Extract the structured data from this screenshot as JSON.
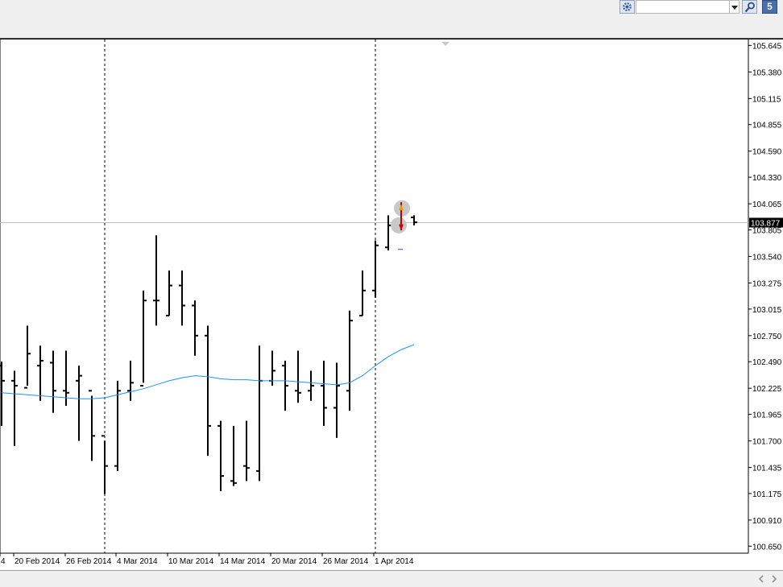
{
  "toolbar": {
    "search_value": "",
    "badge": "5",
    "icons": [
      "gear-icon",
      "chevron-down-icon",
      "search-icon"
    ]
  },
  "price_scale": {
    "labels": [
      "105.645",
      "105.380",
      "105.115",
      "104.855",
      "104.590",
      "104.330",
      "104.065",
      "103.805",
      "103.540",
      "103.275",
      "103.015",
      "102.750",
      "102.490",
      "102.225",
      "101.965",
      "101.700",
      "101.435",
      "101.175",
      "100.910",
      "100.650"
    ],
    "current": "103.877"
  },
  "time_scale": {
    "labels": [
      "4",
      "20 Feb 2014",
      "26 Feb 2014",
      "4 Mar 2014",
      "10 Mar 2014",
      "14 Mar 2014",
      "20 Mar 2014",
      "26 Mar 2014",
      "1 Apr 2014"
    ]
  },
  "chart_data": {
    "type": "bar",
    "title": "",
    "xlabel": "",
    "ylabel": "",
    "ylim": [
      100.58,
      105.68
    ],
    "grid": false,
    "current_price": 103.877,
    "bars": [
      {
        "o": 102.45,
        "h": 102.49,
        "l": 101.85,
        "c": 102.3
      },
      {
        "o": 102.3,
        "h": 102.4,
        "l": 101.65,
        "c": 102.25
      },
      {
        "o": 102.23,
        "h": 102.85,
        "l": 102.25,
        "c": 102.57
      },
      {
        "o": 102.45,
        "h": 102.65,
        "l": 102.1,
        "c": 102.5
      },
      {
        "o": 102.48,
        "h": 102.6,
        "l": 101.98,
        "c": 102.2
      },
      {
        "o": 102.2,
        "h": 102.6,
        "l": 102.05,
        "c": 102.18
      },
      {
        "o": 102.3,
        "h": 102.45,
        "l": 101.7,
        "c": 102.35
      },
      {
        "o": 102.2,
        "h": 102.15,
        "l": 101.5,
        "c": 101.75
      },
      {
        "o": 101.75,
        "h": 101.7,
        "l": 101.17,
        "c": 101.45
      },
      {
        "o": 101.45,
        "h": 102.3,
        "l": 101.4,
        "c": 102.2
      },
      {
        "o": 102.2,
        "h": 102.5,
        "l": 102.1,
        "c": 102.28
      },
      {
        "o": 102.25,
        "h": 103.2,
        "l": 102.28,
        "c": 103.1
      },
      {
        "o": 103.1,
        "h": 103.75,
        "l": 102.85,
        "c": 103.1
      },
      {
        "o": 102.95,
        "h": 103.4,
        "l": 102.95,
        "c": 103.25
      },
      {
        "o": 103.25,
        "h": 103.4,
        "l": 102.85,
        "c": 103.05
      },
      {
        "o": 103.05,
        "h": 103.1,
        "l": 102.55,
        "c": 102.75
      },
      {
        "o": 102.75,
        "h": 102.85,
        "l": 101.55,
        "c": 101.85
      },
      {
        "o": 101.85,
        "h": 101.9,
        "l": 101.2,
        "c": 101.35
      },
      {
        "o": 101.3,
        "h": 101.85,
        "l": 101.25,
        "c": 101.28
      },
      {
        "o": 101.45,
        "h": 101.9,
        "l": 101.3,
        "c": 101.43
      },
      {
        "o": 101.4,
        "h": 102.65,
        "l": 101.3,
        "c": 102.3
      },
      {
        "o": 102.3,
        "h": 102.6,
        "l": 102.25,
        "c": 102.4
      },
      {
        "o": 102.45,
        "h": 102.5,
        "l": 102.0,
        "c": 102.25
      },
      {
        "o": 102.2,
        "h": 102.6,
        "l": 102.08,
        "c": 102.18
      },
      {
        "o": 102.2,
        "h": 102.4,
        "l": 102.1,
        "c": 102.25
      },
      {
        "o": 102.25,
        "h": 102.5,
        "l": 101.85,
        "c": 102.03
      },
      {
        "o": 102.03,
        "h": 102.48,
        "l": 101.73,
        "c": 102.25
      },
      {
        "o": 102.2,
        "h": 103.0,
        "l": 102.0,
        "c": 102.9
      },
      {
        "o": 102.95,
        "h": 103.4,
        "l": 102.95,
        "c": 103.2
      },
      {
        "o": 103.2,
        "h": 103.7,
        "l": 103.13,
        "c": 103.65
      },
      {
        "o": 103.63,
        "h": 103.95,
        "l": 103.6,
        "c": 103.85
      },
      {
        "o": 103.85,
        "h": 104.08,
        "l": 103.8,
        "c": 104.05
      },
      {
        "o": 103.93,
        "h": 103.95,
        "l": 103.85,
        "c": 103.88
      }
    ],
    "moving_average": [
      102.18,
      102.17,
      102.16,
      102.15,
      102.14,
      102.13,
      102.12,
      102.12,
      102.13,
      102.16,
      102.19,
      102.22,
      102.26,
      102.3,
      102.33,
      102.35,
      102.34,
      102.32,
      102.31,
      102.31,
      102.3,
      102.3,
      102.3,
      102.29,
      102.28,
      102.27,
      102.26,
      102.28,
      102.35,
      102.45,
      102.54,
      102.61,
      102.66
    ],
    "period_separators": [
      "26 Feb 2014",
      "1 Apr 2014"
    ]
  }
}
